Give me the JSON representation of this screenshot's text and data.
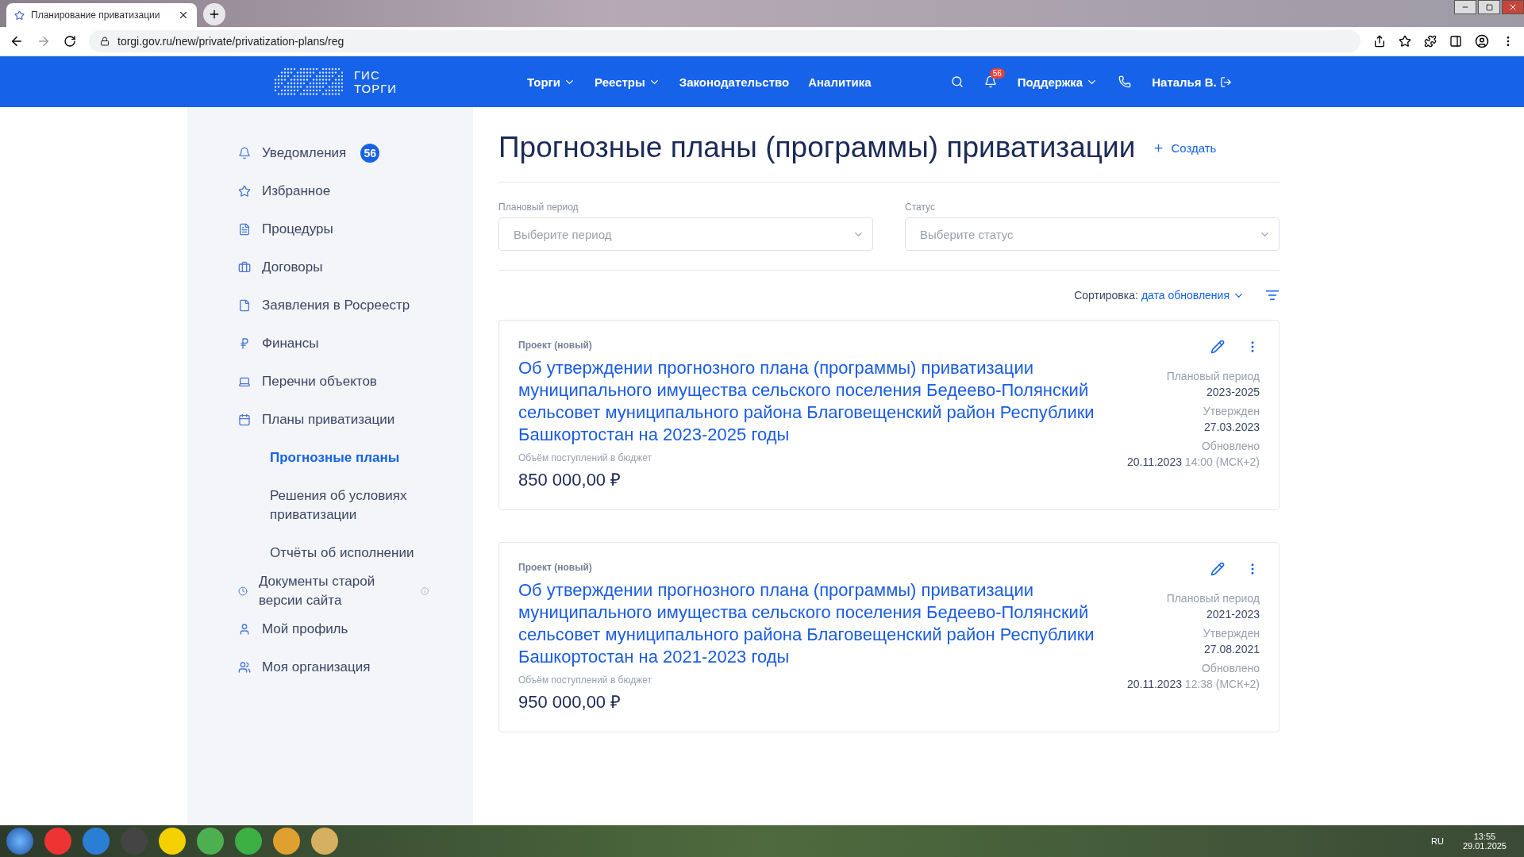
{
  "browser": {
    "tab_title": "Планирование приватизации",
    "url": "torgi.gov.ru/new/private/privatization-plans/reg"
  },
  "header": {
    "logo_lines": [
      "ГИС",
      "ТОРГИ"
    ],
    "nav": [
      {
        "label": "Торги",
        "dropdown": true
      },
      {
        "label": "Реестры",
        "dropdown": true
      },
      {
        "label": "Законодательство",
        "dropdown": false
      },
      {
        "label": "Аналитика",
        "dropdown": false
      }
    ],
    "notifications_badge": "56",
    "support": {
      "label": "Поддержка",
      "dropdown": true
    },
    "user": "Наталья В."
  },
  "sidebar": {
    "items": [
      {
        "label": "Уведомления",
        "badge": "56"
      },
      {
        "label": "Избранное"
      },
      {
        "label": "Процедуры"
      },
      {
        "label": "Договоры"
      },
      {
        "label": "Заявления в Росреестр"
      },
      {
        "label": "Финансы"
      },
      {
        "label": "Перечни объектов"
      },
      {
        "label": "Планы приватизации",
        "children": [
          {
            "label": "Прогнозные планы",
            "selected": true
          },
          {
            "label": "Решения об условиях приватизации",
            "selected": false
          },
          {
            "label": "Отчёты об исполнении",
            "selected": false
          }
        ]
      },
      {
        "label": "Документы старой версии сайта",
        "info": true
      },
      {
        "label": "Мой профиль"
      },
      {
        "label": "Моя организация"
      }
    ]
  },
  "page": {
    "title": "Прогнозные планы (программы) приватизации",
    "create": "Создать",
    "filters": [
      {
        "label": "Плановый период",
        "placeholder": "Выберите период"
      },
      {
        "label": "Статус",
        "placeholder": "Выберите статус"
      }
    ],
    "sort": {
      "label": "Сортировка:",
      "value": "дата обновления"
    },
    "cards": [
      {
        "status": "Проект (новый)",
        "title": "Об утверждении прогнозного плана (программы) приватизации муниципального имущества сельского поселения Бедеево-Полянский сельсовет муниципального района Благовещенский район Республики Башкортостан на 2023-2025 годы",
        "budget_label": "Объём поступлений в бюджет",
        "budget": "850 000,00 ₽",
        "meta": [
          {
            "label": "Плановый период",
            "value": "2023-2025"
          },
          {
            "label": "Утвержден",
            "value": "27.03.2023"
          },
          {
            "label": "Обновлено",
            "value": "20.11.2023",
            "extra": "14:00 (МСК+2)"
          }
        ]
      },
      {
        "status": "Проект (новый)",
        "title": "Об утверждении прогнозного плана (программы) приватизации муниципального имущества сельского поселения Бедеево-Полянский сельсовет муниципального района Благовещенский район Республики Башкортостан на 2021-2023 годы",
        "budget_label": "Объём поступлений в бюджет",
        "budget": "950 000,00 ₽",
        "meta": [
          {
            "label": "Плановый период",
            "value": "2021-2023"
          },
          {
            "label": "Утвержден",
            "value": "27.08.2021"
          },
          {
            "label": "Обновлено",
            "value": "20.11.2023",
            "extra": "12:38 (МСК+2)"
          }
        ]
      }
    ]
  },
  "taskbar": {
    "language": "RU",
    "time": "13:55",
    "date": "29.01.2025"
  }
}
